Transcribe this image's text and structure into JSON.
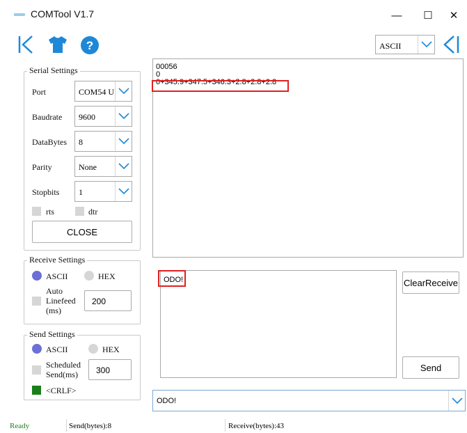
{
  "window": {
    "title": "COMTool V1.7",
    "minimize": "—",
    "maximize": "☐",
    "close": "✕"
  },
  "toolbar": {
    "format": "ASCII"
  },
  "serial_settings": {
    "title": "Serial Settings",
    "port_label": "Port",
    "port_value": "COM54 U",
    "baudrate_label": "Baudrate",
    "baudrate_value": "9600",
    "databytes_label": "DataBytes",
    "databytes_value": "8",
    "parity_label": "Parity",
    "parity_value": "None",
    "stopbits_label": "Stopbits",
    "stopbits_value": "1",
    "rts_label": "rts",
    "dtr_label": "dtr",
    "close_button": "CLOSE"
  },
  "receive_settings": {
    "title": "Receive Settings",
    "ascii_label": "ASCII",
    "hex_label": "HEX",
    "autolinefeed_label_1": "Auto",
    "autolinefeed_label_2": "Linefeed",
    "autolinefeed_label_3": "(ms)",
    "autolinefeed_value": "200"
  },
  "send_settings": {
    "title": "Send Settings",
    "ascii_label": "ASCII",
    "hex_label": "HEX",
    "scheduled_label_1": "Scheduled",
    "scheduled_label_2": "Send(ms)",
    "scheduled_value": "300",
    "crlf_label": "<CRLF>"
  },
  "receive": {
    "lines": [
      "00056",
      "0",
      "0+345.9+347.5+346.3+2.8+2.8+2.8"
    ]
  },
  "send": {
    "text": "ODO!",
    "history_value": "ODO!",
    "clear_receive_button": "ClearReceive",
    "send_button": "Send"
  },
  "status": {
    "state": "Ready",
    "sent": "Send(bytes):8",
    "received": "Receive(bytes):43"
  },
  "colors": {
    "accent": "#1e88d8",
    "radio_on": "#6b6fd6",
    "crlf_checked": "#1a7f1a",
    "highlight": "#e02020",
    "ready": "#1a7f1a"
  }
}
